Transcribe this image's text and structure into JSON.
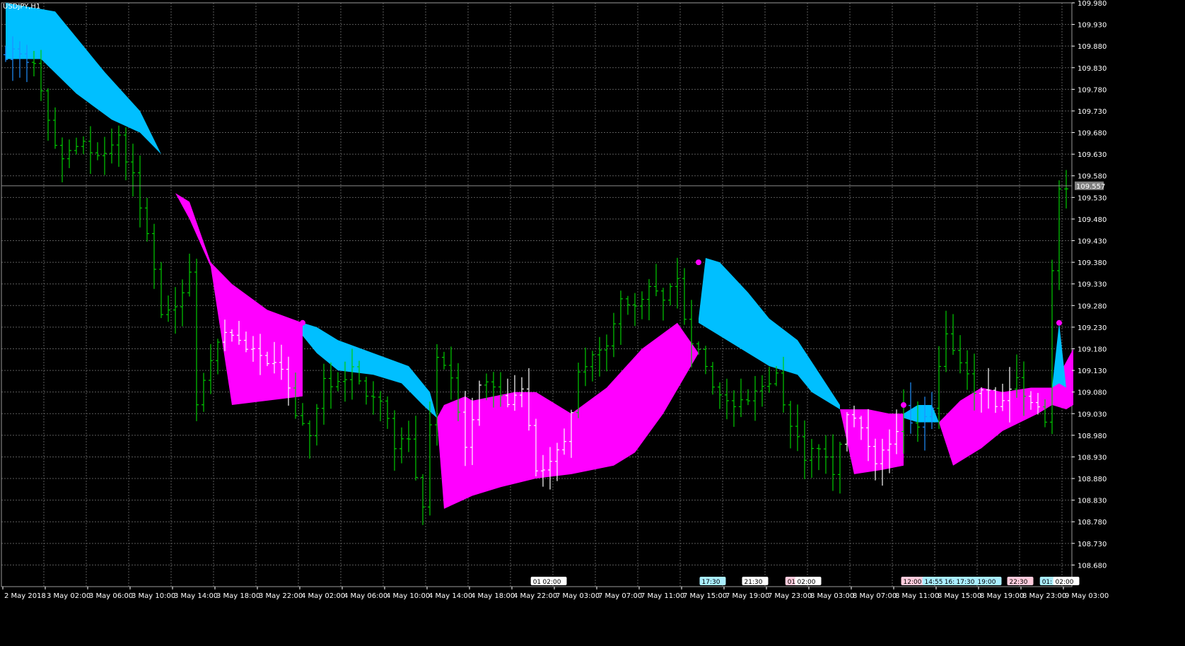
{
  "symbol_label": "USDJPY,H1",
  "current_price": "109.557",
  "colors": {
    "background": "#000000",
    "grid": "#5a5a5a",
    "bar_default": "#00cc00",
    "bar_in_band": "#ffffff",
    "bar_in_up_band": "#1e90ff",
    "band_up": "#00bfff",
    "band_down": "#ff00ff",
    "dot": "#ff00ff",
    "axis_text": "#ffffff"
  },
  "chart_data": {
    "type": "ohlc_bars_with_bands",
    "ylim": [
      108.63,
      109.98
    ],
    "x_count": 168,
    "price_ticks": [
      "109.980",
      "109.930",
      "109.880",
      "109.830",
      "109.780",
      "109.730",
      "109.680",
      "109.630",
      "109.580",
      "109.530",
      "109.480",
      "109.430",
      "109.380",
      "109.330",
      "109.280",
      "109.230",
      "109.180",
      "109.130",
      "109.080",
      "109.030",
      "108.980",
      "108.930",
      "108.880",
      "108.830",
      "108.780",
      "108.730",
      "108.680"
    ],
    "price_tick_values": [
      109.98,
      109.93,
      109.88,
      109.83,
      109.78,
      109.73,
      109.68,
      109.63,
      109.58,
      109.53,
      109.48,
      109.43,
      109.38,
      109.33,
      109.28,
      109.23,
      109.18,
      109.13,
      109.08,
      109.03,
      108.98,
      108.93,
      108.88,
      108.83,
      108.78,
      108.73,
      108.68
    ],
    "time_ticks": [
      {
        "i": 0,
        "label": "2 May 2018"
      },
      {
        "i": 6,
        "label": "3 May 02:00"
      },
      {
        "i": 12,
        "label": "3 May 06:00"
      },
      {
        "i": 18,
        "label": "3 May 10:00"
      },
      {
        "i": 24,
        "label": "3 May 14:00"
      },
      {
        "i": 30,
        "label": "3 May 18:00"
      },
      {
        "i": 36,
        "label": "3 May 22:00"
      },
      {
        "i": 42,
        "label": "4 May 02:00"
      },
      {
        "i": 48,
        "label": "4 May 06:00"
      },
      {
        "i": 54,
        "label": "4 May 10:00"
      },
      {
        "i": 60,
        "label": "4 May 14:00"
      },
      {
        "i": 66,
        "label": "4 May 18:00"
      },
      {
        "i": 72,
        "label": "4 May 22:00"
      },
      {
        "i": 78,
        "label": "7 May 03:00"
      },
      {
        "i": 84,
        "label": "7 May 07:00"
      },
      {
        "i": 90,
        "label": "7 May 11:00"
      },
      {
        "i": 96,
        "label": "7 May 15:00"
      },
      {
        "i": 102,
        "label": "7 May 19:00"
      },
      {
        "i": 108,
        "label": "7 May 23:00"
      },
      {
        "i": 114,
        "label": "8 May 03:00"
      },
      {
        "i": 120,
        "label": "8 May 07:00"
      },
      {
        "i": 126,
        "label": "8 May 11:00"
      },
      {
        "i": 132,
        "label": "8 May 15:00"
      },
      {
        "i": 138,
        "label": "8 May 19:00"
      },
      {
        "i": 144,
        "label": "8 May 23:00"
      },
      {
        "i": 150,
        "label": "9 May 03:00"
      }
    ],
    "time_markers": [
      {
        "i": 75.5,
        "label": "01:",
        "bg": "#ffffff"
      },
      {
        "i": 77.5,
        "label": "02:00",
        "bg": "#ffffff"
      },
      {
        "i": 100,
        "label": "17:30",
        "bg": "#aaeeff"
      },
      {
        "i": 106,
        "label": "21:30",
        "bg": "#ffffff"
      },
      {
        "i": 111.5,
        "label": "01:",
        "bg": "#ffccdd"
      },
      {
        "i": 113.5,
        "label": "02:00",
        "bg": "#ffffff"
      },
      {
        "i": 128.5,
        "label": "12:00",
        "bg": "#ffccdd"
      },
      {
        "i": 131.5,
        "label": "14:55",
        "bg": "#aaeeff"
      },
      {
        "i": 133.7,
        "label": "16:",
        "bg": "#aaeeff"
      },
      {
        "i": 136,
        "label": "17:30",
        "bg": "#aaeeff"
      },
      {
        "i": 139,
        "label": "19:00",
        "bg": "#aaeeff"
      },
      {
        "i": 143.5,
        "label": "22:30",
        "bg": "#ffccdd"
      },
      {
        "i": 147.5,
        "label": "01:",
        "bg": "#aaeeff"
      },
      {
        "i": 150,
        "label": "02:00",
        "bg": "#ffffff"
      }
    ],
    "bands": [
      {
        "type": "up",
        "upper": [
          [
            0,
            109.98
          ],
          [
            7,
            109.96
          ],
          [
            14,
            109.82
          ],
          [
            19,
            109.73
          ],
          [
            22,
            109.63
          ],
          [
            24,
            109.55
          ]
        ],
        "lower": [
          [
            0,
            109.85
          ],
          [
            5,
            109.85
          ],
          [
            10,
            109.77
          ],
          [
            15,
            109.71
          ],
          [
            19,
            109.68
          ],
          [
            22,
            109.63
          ],
          [
            24,
            109.55
          ]
        ]
      },
      {
        "type": "down",
        "upper": [
          [
            24,
            109.54
          ],
          [
            26,
            109.52
          ],
          [
            29,
            109.38
          ],
          [
            32,
            109.33
          ],
          [
            37,
            109.27
          ],
          [
            42,
            109.24
          ]
        ],
        "lower": [
          [
            24,
            109.54
          ],
          [
            26,
            109.48
          ],
          [
            29,
            109.37
          ],
          [
            32,
            109.05
          ],
          [
            42,
            109.07
          ]
        ]
      },
      {
        "type": "up",
        "upper": [
          [
            42,
            109.24
          ],
          [
            44,
            109.23
          ],
          [
            47,
            109.2
          ],
          [
            52,
            109.17
          ],
          [
            57,
            109.14
          ],
          [
            60,
            109.08
          ],
          [
            61,
            109.02
          ]
        ],
        "lower": [
          [
            42,
            109.21
          ],
          [
            44,
            109.17
          ],
          [
            47,
            109.13
          ],
          [
            52,
            109.12
          ],
          [
            56,
            109.1
          ],
          [
            59,
            109.05
          ],
          [
            61,
            109.02
          ]
        ]
      },
      {
        "type": "down",
        "upper": [
          [
            61,
            109.02
          ],
          [
            62,
            109.05
          ],
          [
            65,
            109.07
          ],
          [
            66,
            109.06
          ],
          [
            72,
            109.08
          ],
          [
            75,
            109.08
          ],
          [
            80,
            109.03
          ],
          [
            85,
            109.09
          ],
          [
            90,
            109.18
          ],
          [
            95,
            109.24
          ]
        ],
        "lower": [
          [
            61,
            109.02
          ],
          [
            62,
            108.81
          ],
          [
            66,
            108.84
          ],
          [
            70,
            108.86
          ],
          [
            75,
            108.88
          ],
          [
            80,
            108.89
          ],
          [
            86,
            108.91
          ],
          [
            89,
            108.94
          ],
          [
            93,
            109.03
          ],
          [
            98,
            109.17
          ]
        ]
      },
      {
        "type": "up",
        "upper": [
          [
            98,
            109.25
          ],
          [
            99,
            109.39
          ],
          [
            101,
            109.38
          ],
          [
            105,
            109.31
          ],
          [
            108,
            109.25
          ],
          [
            112,
            109.2
          ],
          [
            114,
            109.15
          ],
          [
            116,
            109.1
          ],
          [
            118,
            109.05
          ]
        ],
        "lower": [
          [
            98,
            109.24
          ],
          [
            101,
            109.21
          ],
          [
            105,
            109.17
          ],
          [
            108,
            109.14
          ],
          [
            112,
            109.12
          ],
          [
            114,
            109.08
          ],
          [
            118,
            109.04
          ]
        ]
      },
      {
        "type": "down",
        "upper": [
          [
            118,
            109.04
          ],
          [
            122,
            109.04
          ],
          [
            125,
            109.03
          ],
          [
            127,
            109.03
          ]
        ],
        "lower": [
          [
            118,
            109.04
          ],
          [
            120,
            108.89
          ],
          [
            124,
            108.9
          ],
          [
            127,
            108.91
          ]
        ]
      },
      {
        "type": "up",
        "upper": [
          [
            127,
            109.03
          ],
          [
            129,
            109.05
          ],
          [
            131,
            109.05
          ],
          [
            132,
            109.01
          ]
        ],
        "lower": [
          [
            127,
            109.02
          ],
          [
            129,
            109.01
          ],
          [
            131,
            109.01
          ],
          [
            132,
            109.01
          ]
        ]
      },
      {
        "type": "down",
        "upper": [
          [
            132,
            109.01
          ],
          [
            135,
            109.06
          ],
          [
            138,
            109.09
          ],
          [
            141,
            109.08
          ],
          [
            145,
            109.09
          ],
          [
            148,
            109.09
          ],
          [
            151,
            109.18
          ]
        ],
        "lower": [
          [
            132,
            109.01
          ],
          [
            134,
            108.91
          ],
          [
            138,
            108.95
          ],
          [
            141,
            108.99
          ],
          [
            146,
            109.03
          ],
          [
            148,
            109.05
          ],
          [
            150,
            109.04
          ],
          [
            151,
            109.05
          ]
        ]
      },
      {
        "type": "up",
        "upper": [
          [
            148,
            109.09
          ],
          [
            149,
            109.24
          ],
          [
            150,
            109.09
          ]
        ],
        "lower": [
          [
            148,
            109.09
          ],
          [
            149,
            109.1
          ],
          [
            150,
            109.09
          ]
        ]
      }
    ],
    "dots": [
      {
        "i": 42,
        "v": 109.24
      },
      {
        "i": 98,
        "v": 109.38
      },
      {
        "i": 127,
        "v": 109.05
      },
      {
        "i": 149,
        "v": 109.24
      }
    ],
    "ohlc_seed": 20180502,
    "anchors": [
      [
        0,
        109.86
      ],
      [
        3,
        109.86
      ],
      [
        5,
        109.85
      ],
      [
        7,
        109.7
      ],
      [
        9,
        109.63
      ],
      [
        11,
        109.66
      ],
      [
        13,
        109.64
      ],
      [
        15,
        109.63
      ],
      [
        17,
        109.66
      ],
      [
        19,
        109.58
      ],
      [
        21,
        109.45
      ],
      [
        23,
        109.25
      ],
      [
        25,
        109.27
      ],
      [
        27,
        109.35
      ],
      [
        28,
        109.05
      ],
      [
        30,
        109.15
      ],
      [
        32,
        109.23
      ],
      [
        34,
        109.19
      ],
      [
        36,
        109.19
      ],
      [
        38,
        109.16
      ],
      [
        40,
        109.13
      ],
      [
        42,
        109.03
      ],
      [
        44,
        108.99
      ],
      [
        46,
        109.1
      ],
      [
        48,
        109.1
      ],
      [
        50,
        109.14
      ],
      [
        52,
        109.08
      ],
      [
        54,
        109.05
      ],
      [
        56,
        108.96
      ],
      [
        58,
        108.96
      ],
      [
        60,
        108.82
      ],
      [
        62,
        109.17
      ],
      [
        64,
        109.12
      ],
      [
        66,
        108.96
      ],
      [
        68,
        109.09
      ],
      [
        70,
        109.1
      ],
      [
        72,
        109.05
      ],
      [
        74,
        109.1
      ],
      [
        76,
        108.9
      ],
      [
        78,
        108.92
      ],
      [
        80,
        108.96
      ],
      [
        82,
        109.12
      ],
      [
        84,
        109.17
      ],
      [
        86,
        109.2
      ],
      [
        88,
        109.3
      ],
      [
        90,
        109.28
      ],
      [
        92,
        109.32
      ],
      [
        94,
        109.29
      ],
      [
        96,
        109.33
      ],
      [
        98,
        109.19
      ],
      [
        100,
        109.14
      ],
      [
        102,
        109.07
      ],
      [
        104,
        109.04
      ],
      [
        106,
        109.06
      ],
      [
        108,
        109.09
      ],
      [
        110,
        109.12
      ],
      [
        112,
        109.01
      ],
      [
        114,
        108.92
      ],
      [
        116,
        108.96
      ],
      [
        118,
        108.9
      ],
      [
        120,
        109.04
      ],
      [
        122,
        109.0
      ],
      [
        124,
        108.92
      ],
      [
        126,
        108.95
      ],
      [
        128,
        109.04
      ],
      [
        130,
        109.0
      ],
      [
        132,
        109.05
      ],
      [
        134,
        109.22
      ],
      [
        136,
        109.16
      ],
      [
        138,
        109.08
      ],
      [
        140,
        109.07
      ],
      [
        142,
        109.05
      ],
      [
        144,
        109.1
      ],
      [
        146,
        109.06
      ],
      [
        148,
        109.02
      ],
      [
        149,
        109.35
      ],
      [
        150,
        109.56
      ]
    ]
  }
}
